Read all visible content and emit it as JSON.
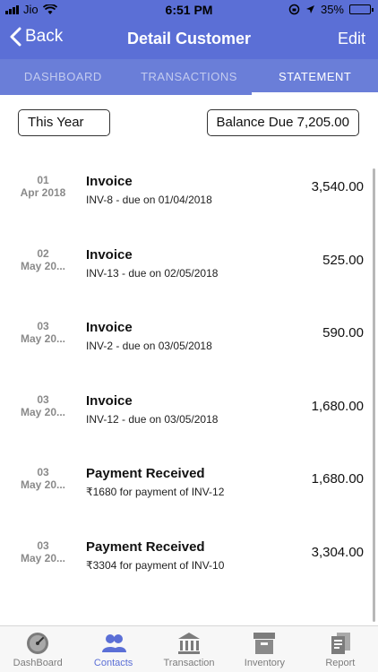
{
  "status_bar": {
    "carrier": "Jio",
    "time": "6:51 PM",
    "battery": "35%",
    "battery_level": 0.35
  },
  "nav": {
    "back_label": "Back",
    "title": "Detail Customer",
    "edit_label": "Edit"
  },
  "tabs": [
    {
      "label": "DASHBOARD",
      "active": false
    },
    {
      "label": "TRANSACTIONS",
      "active": false
    },
    {
      "label": "STATEMENT",
      "active": true
    }
  ],
  "filter": {
    "period": "This Year",
    "balance_due": "Balance Due 7,205.00"
  },
  "entries": [
    {
      "day": "01",
      "month": "Apr 2018",
      "title": "Invoice",
      "sub": "INV-8 - due on 01/04/2018",
      "amount": "3,540.00"
    },
    {
      "day": "02",
      "month": "May 20...",
      "title": "Invoice",
      "sub": "INV-13 - due on 02/05/2018",
      "amount": "525.00"
    },
    {
      "day": "03",
      "month": "May 20...",
      "title": "Invoice",
      "sub": "INV-2 - due on 03/05/2018",
      "amount": "590.00"
    },
    {
      "day": "03",
      "month": "May 20...",
      "title": "Invoice",
      "sub": "INV-12 - due on 03/05/2018",
      "amount": "1,680.00"
    },
    {
      "day": "03",
      "month": "May 20...",
      "title": "Payment Received",
      "sub": "₹1680 for payment of INV-12",
      "amount": "1,680.00"
    },
    {
      "day": "03",
      "month": "May 20...",
      "title": "Payment Received",
      "sub": "₹3304 for payment of INV-10",
      "amount": "3,304.00"
    }
  ],
  "bottom_tabs": [
    {
      "label": "DashBoard",
      "icon": "gauge-icon",
      "active": false
    },
    {
      "label": "Contacts",
      "icon": "contacts-icon",
      "active": true
    },
    {
      "label": "Transaction",
      "icon": "bank-icon",
      "active": false
    },
    {
      "label": "Inventory",
      "icon": "box-icon",
      "active": false
    },
    {
      "label": "Report",
      "icon": "report-icon",
      "active": false
    }
  ],
  "colors": {
    "primary": "#5b6fd6",
    "tab_bar": "#6a7ed8",
    "active_bottom": "#5b6fd6",
    "inactive_bottom": "#7c7c7c"
  }
}
